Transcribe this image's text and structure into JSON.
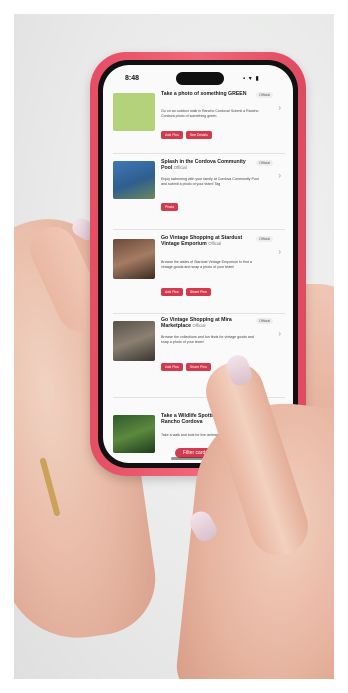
{
  "status_bar": {
    "time": "8:48",
    "icons": "▪ ▾ ▮"
  },
  "cards": [
    {
      "title": "Take a photo of something GREEN",
      "desc": "Go on an outdoor walk in Rancho Cordova! Submit a Rancho Cordova photo of something green.",
      "badge": "Official",
      "buttons": [
        "Add Pics",
        "See Details"
      ]
    },
    {
      "title": "Splash in the Cordova Community Pool",
      "sub": "Official",
      "desc": "Enjoy swimming with your family at Cordova Community Pool and submit a photo of your team! Tag",
      "badge": "Official",
      "buttons": [
        "Photo"
      ]
    },
    {
      "title": "Go Vintage Shopping at Stardust Vintage Emporium",
      "sub": "Official",
      "desc": "Browse the aisles of Stardust Vintage Emporium to find a vintage goods and snap a photo of your team!",
      "badge": "Official",
      "buttons": [
        "Add Pics",
        "Share Pics"
      ]
    },
    {
      "title": "Go Vintage Shopping at Mira Marketplace",
      "sub": "Official",
      "desc": "Browse the collections and fun finds for vintage goods and snap a photo of your team!",
      "badge": "Official",
      "buttons": [
        "Add Pics",
        "Share Pics"
      ]
    },
    {
      "title": "Take a Wildlife Spotting Walk in Rancho Cordova",
      "desc": "Take a walk and look for live animals to photograph!",
      "badge": "",
      "buttons": []
    }
  ],
  "filter_button": "Filter cards",
  "colors": {
    "phone_case": "#ef5a70",
    "accent": "#d23a4f"
  }
}
